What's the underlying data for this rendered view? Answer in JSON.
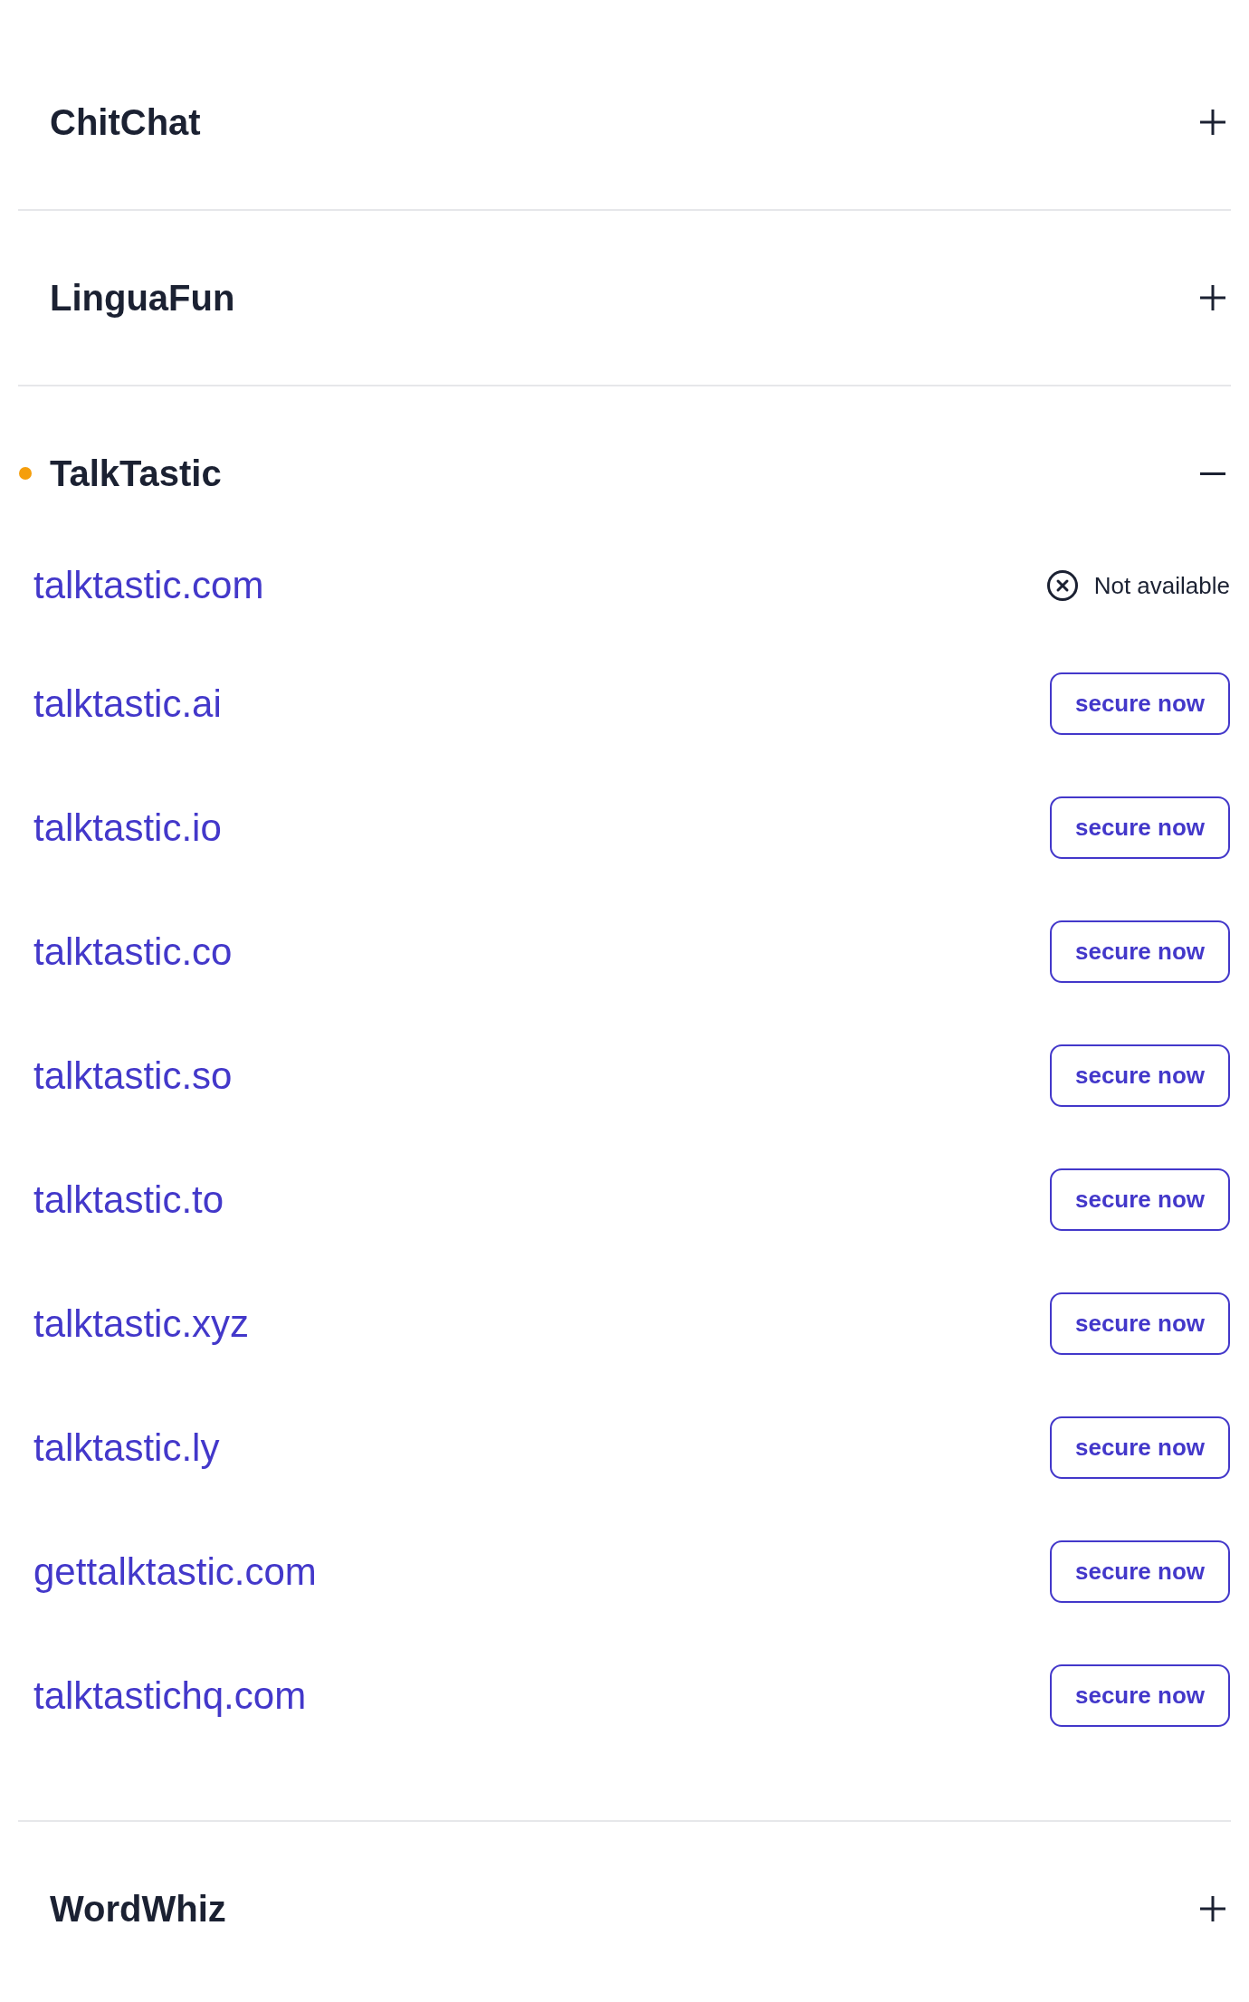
{
  "sections": [
    {
      "title": "ChitChat",
      "expanded": false,
      "highlighted": false
    },
    {
      "title": "LinguaFun",
      "expanded": false,
      "highlighted": false
    },
    {
      "title": "TalkTastic",
      "expanded": true,
      "highlighted": true,
      "domains": [
        {
          "name": "talktastic.com",
          "available": false,
          "status": "Not available"
        },
        {
          "name": "talktastic.ai",
          "available": true,
          "action": "secure now"
        },
        {
          "name": "talktastic.io",
          "available": true,
          "action": "secure now"
        },
        {
          "name": "talktastic.co",
          "available": true,
          "action": "secure now"
        },
        {
          "name": "talktastic.so",
          "available": true,
          "action": "secure now"
        },
        {
          "name": "talktastic.to",
          "available": true,
          "action": "secure now"
        },
        {
          "name": "talktastic.xyz",
          "available": true,
          "action": "secure now"
        },
        {
          "name": "talktastic.ly",
          "available": true,
          "action": "secure now"
        },
        {
          "name": "gettalktastic.com",
          "available": true,
          "action": "secure now"
        },
        {
          "name": "talktastichq.com",
          "available": true,
          "action": "secure now"
        }
      ]
    },
    {
      "title": "WordWhiz",
      "expanded": false,
      "highlighted": false
    }
  ]
}
